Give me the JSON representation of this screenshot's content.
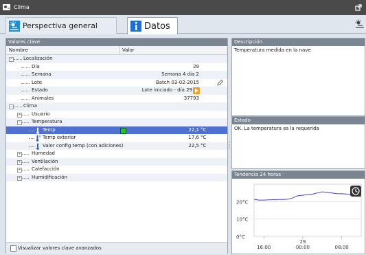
{
  "window": {
    "title": "Clima"
  },
  "tabs": [
    {
      "label": "Perspectiva general"
    },
    {
      "label": "Datos"
    }
  ],
  "key_values": {
    "panel_title": "Valores clave",
    "col_name": "Nombre",
    "col_value": "Valor",
    "rows": [
      {
        "label": "Localización"
      },
      {
        "label": "Día",
        "value": "29"
      },
      {
        "label": "Semana",
        "value": "Semana 4 día 2"
      },
      {
        "label": "Lote",
        "value": "Batch 03-02-2015"
      },
      {
        "label": "Estado",
        "value": "Lote iniciado - día 29"
      },
      {
        "label": "Animales",
        "value": "37793"
      },
      {
        "label": "Clima"
      },
      {
        "label": "Usuario"
      },
      {
        "label": "Temperatura"
      },
      {
        "label": "Temp",
        "value": "22,1",
        "unit": "°C"
      },
      {
        "label": "Temp exterior",
        "value": "17,6",
        "unit": "°C"
      },
      {
        "label": "Valor config temp (con adiciones)",
        "value": "22,5",
        "unit": "°C"
      },
      {
        "label": "Humedad"
      },
      {
        "label": "Ventilación"
      },
      {
        "label": "Calefacción"
      },
      {
        "label": "Humidificación"
      }
    ],
    "checkbox_label": "Visualizar valores clave avanzados"
  },
  "description": {
    "title": "Descripción",
    "text": "Temperatura medida en la nave"
  },
  "status": {
    "title": "Estado",
    "text": "OK. La temperatura es la requerida"
  },
  "trend": {
    "title": "Tendencia 24 horas",
    "y_ticks": [
      "20°C",
      "10°C",
      "0°C"
    ],
    "x_ticks": [
      "16:00",
      "00:00",
      "08:00"
    ],
    "day_label": "29"
  },
  "chart_data": {
    "type": "line",
    "title": "Tendencia 24 horas",
    "x": [
      "14:00",
      "15:00",
      "16:00",
      "17:00",
      "18:00",
      "19:00",
      "20:00",
      "21:00",
      "22:00",
      "23:00",
      "00:00",
      "01:00",
      "02:00",
      "03:00",
      "04:00",
      "05:00",
      "06:00",
      "07:00",
      "08:00",
      "09:00",
      "10:00",
      "11:00",
      "12:00"
    ],
    "series": [
      {
        "values": [
          21.3,
          20.9,
          20.9,
          21.0,
          21.1,
          21.2,
          21.2,
          21.4,
          22.2,
          23.4,
          23.7,
          24.0,
          24.3,
          25.0,
          25.6,
          25.3,
          25.0,
          24.6,
          24.5,
          24.4,
          24.0,
          23.5,
          22.9
        ]
      }
    ],
    "ylim": [
      0,
      30
    ],
    "grid": true,
    "color": "#4040d0"
  },
  "colors": {
    "selected_row": "#4f6fd1",
    "ok_indicator": "#22c822",
    "panel_header": "#7b8491"
  }
}
